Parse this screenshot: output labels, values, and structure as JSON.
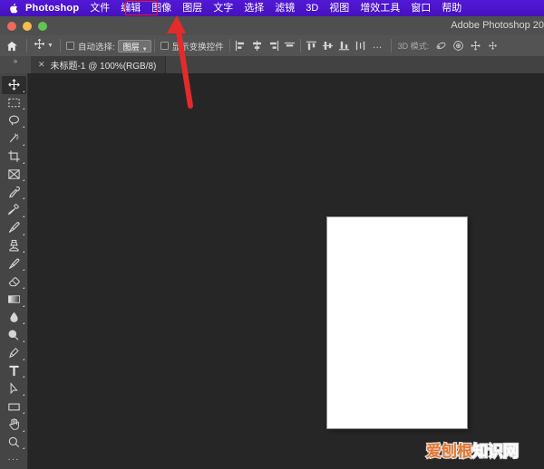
{
  "menubar": {
    "apple_icon": "apple-logo-icon",
    "app_name": "Photoshop",
    "items": [
      {
        "label": "文件",
        "name": "menu-file"
      },
      {
        "label": "编辑",
        "name": "menu-edit"
      },
      {
        "label": "图像",
        "name": "menu-image"
      },
      {
        "label": "图层",
        "name": "menu-layer"
      },
      {
        "label": "文字",
        "name": "menu-type"
      },
      {
        "label": "选择",
        "name": "menu-select"
      },
      {
        "label": "滤镜",
        "name": "menu-filter"
      },
      {
        "label": "3D",
        "name": "menu-3d"
      },
      {
        "label": "视图",
        "name": "menu-view"
      },
      {
        "label": "增效工具",
        "name": "menu-plugins"
      },
      {
        "label": "窗口",
        "name": "menu-window"
      },
      {
        "label": "帮助",
        "name": "menu-help"
      }
    ],
    "highlighted_item": "编辑",
    "bar_color": "#4a14c4"
  },
  "titlebar": {
    "title": "Adobe Photoshop 20",
    "traffic_lights": [
      "close-button",
      "minimize-button",
      "zoom-button"
    ],
    "colors": {
      "close": "#ed6a5e",
      "minimize": "#f5bd4f",
      "zoom": "#61c454"
    }
  },
  "options_bar": {
    "home_icon": "home-icon",
    "active_tool_icon": "move-tool-icon",
    "auto_select_label": "自动选择:",
    "auto_select_value": "图层",
    "auto_select_checked": false,
    "show_transform_label": "显示变换控件",
    "show_transform_checked": false,
    "align_buttons": [
      "align-left-edges",
      "align-horizontal-centers",
      "align-right-edges",
      "align-top-edges",
      "distribute-top-edges",
      "distribute-vertical-centers",
      "distribute-bottom-edges",
      "distribute-spacing"
    ],
    "more_label": "…",
    "mode_3d_label": "3D 模式:",
    "mode_3d_buttons": [
      "rotate-3d-icon",
      "roll-3d-icon",
      "pan-3d-icon",
      "slide-3d-icon"
    ]
  },
  "tabbar": {
    "gripper_icon": "panel-gripper-icon",
    "close_icon": "close-tab-icon",
    "document_title": "未标题-1 @ 100%(RGB/8)"
  },
  "toolbox": {
    "tools": [
      {
        "name": "move-tool",
        "active": true
      },
      {
        "name": "rectangular-marquee-tool",
        "active": false
      },
      {
        "name": "lasso-tool",
        "active": false
      },
      {
        "name": "magic-wand-tool",
        "active": false
      },
      {
        "name": "crop-tool",
        "active": false
      },
      {
        "name": "frame-tool",
        "active": false
      },
      {
        "name": "eyedropper-tool",
        "active": false
      },
      {
        "name": "spot-healing-brush-tool",
        "active": false
      },
      {
        "name": "brush-tool",
        "active": false
      },
      {
        "name": "clone-stamp-tool",
        "active": false
      },
      {
        "name": "history-brush-tool",
        "active": false
      },
      {
        "name": "eraser-tool",
        "active": false
      },
      {
        "name": "gradient-tool",
        "active": false
      },
      {
        "name": "blur-tool",
        "active": false
      },
      {
        "name": "dodge-tool",
        "active": false
      },
      {
        "name": "pen-tool",
        "active": false
      },
      {
        "name": "type-tool",
        "active": false
      },
      {
        "name": "path-selection-tool",
        "active": false
      },
      {
        "name": "rectangle-tool",
        "active": false
      },
      {
        "name": "hand-tool",
        "active": false
      },
      {
        "name": "zoom-tool",
        "active": false
      }
    ],
    "more_tools_label": "···"
  },
  "canvas": {
    "background_color": "#262626",
    "artboard_color": "#ffffff",
    "zoom_level": "100%"
  },
  "annotations": {
    "highlight_box_color": "#e02020",
    "arrow_color": "#e32b2b",
    "arrow_target": "编辑"
  },
  "watermark": {
    "text_orange": "爱刨根",
    "text_white": "知识网",
    "orange_color": "#e8762c",
    "white_color": "#ffffff"
  }
}
